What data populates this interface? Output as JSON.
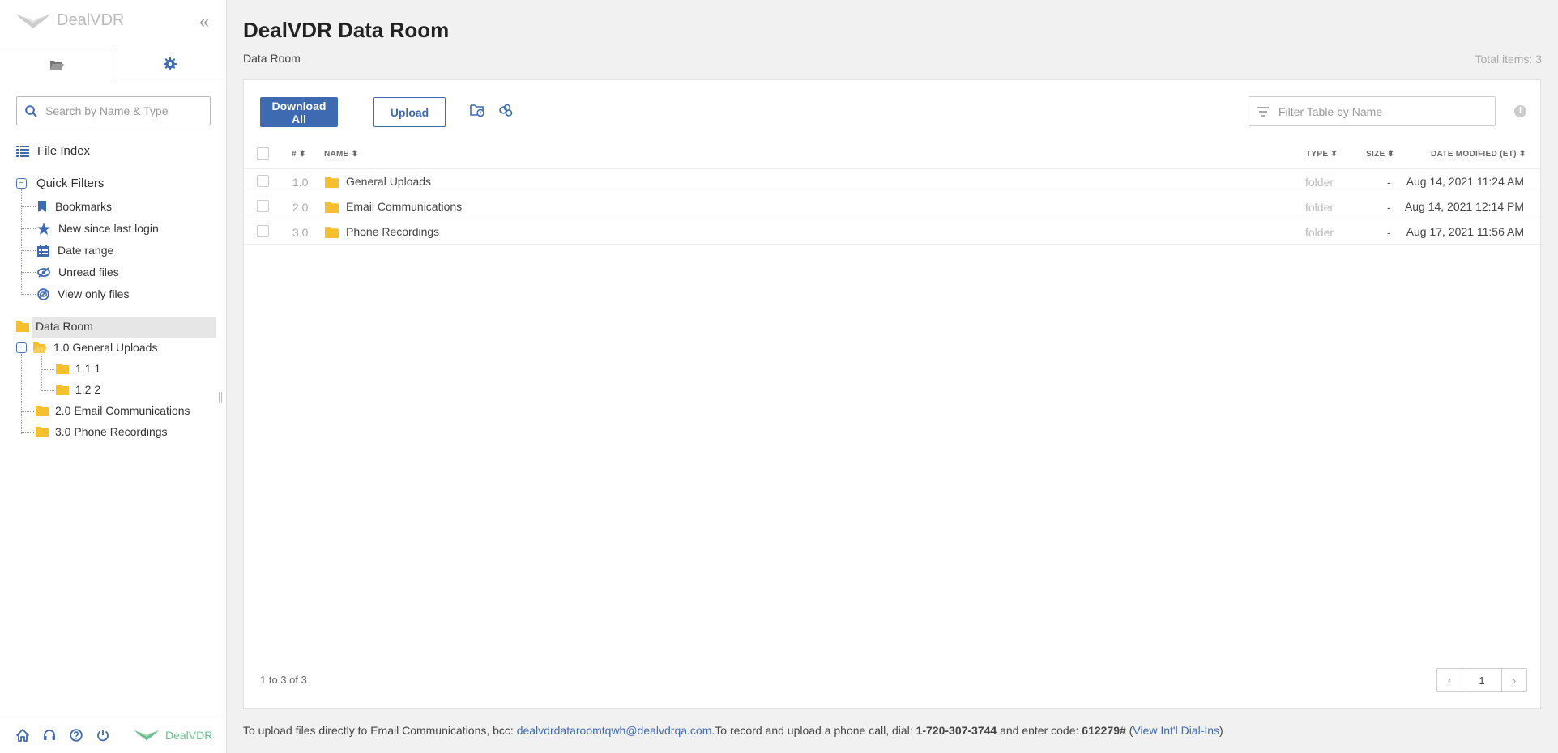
{
  "app": {
    "name": "DealVDR"
  },
  "sidebar": {
    "search_placeholder": "Search by Name & Type",
    "file_index": "File Index",
    "quick_filters": {
      "label": "Quick Filters",
      "items": [
        {
          "label": "Bookmarks",
          "icon": "bookmark-icon"
        },
        {
          "label": "New since last login",
          "icon": "star-icon"
        },
        {
          "label": "Date range",
          "icon": "calendar-icon"
        },
        {
          "label": "Unread files",
          "icon": "eye-slash-icon"
        },
        {
          "label": "View only files",
          "icon": "view-only-icon"
        }
      ]
    },
    "tree": {
      "root": "Data Room",
      "folders": [
        {
          "label": "1.0 General Uploads",
          "children": [
            {
              "label": "1.1 1"
            },
            {
              "label": "1.2 2"
            }
          ]
        },
        {
          "label": "2.0 Email Communications"
        },
        {
          "label": "3.0 Phone Recordings"
        }
      ]
    },
    "footer_logo": "DealVDR"
  },
  "main": {
    "title": "DealVDR Data Room",
    "breadcrumb": "Data Room",
    "total_items": "Total items: 3",
    "toolbar": {
      "download_all": "Download All",
      "upload": "Upload"
    },
    "filter_placeholder": "Filter Table by Name",
    "info": "i",
    "columns": {
      "num": "#",
      "name": "NAME",
      "type": "TYPE",
      "size": "SIZE",
      "date": "DATE MODIFIED (ET)"
    },
    "rows": [
      {
        "num": "1.0",
        "name": "General Uploads",
        "type": "folder",
        "size": "-",
        "date": "Aug 14, 2021 11:24 AM"
      },
      {
        "num": "2.0",
        "name": "Email Communications",
        "type": "folder",
        "size": "-",
        "date": "Aug 14, 2021 12:14 PM"
      },
      {
        "num": "3.0",
        "name": "Phone Recordings",
        "type": "folder",
        "size": "-",
        "date": "Aug 17, 2021 11:56 AM"
      }
    ],
    "count": "1 to 3 of 3",
    "page": "1"
  },
  "bottom_note": {
    "text1": "To upload files directly to Email Communications, bcc: ",
    "email": "dealvdrdataroomtqwh@dealvdrqa.com",
    "text2": ".To record and upload a phone call, dial: ",
    "phone": "1-720-307-3744",
    "text3": " and enter code: ",
    "code": "612279#",
    "text4": " (",
    "link": "View Int'l Dial-Ins",
    "text5": ")"
  },
  "colors": {
    "accent": "#3e6ab2",
    "folder": "#f5c02d",
    "green_logo": "#6abf8e"
  }
}
